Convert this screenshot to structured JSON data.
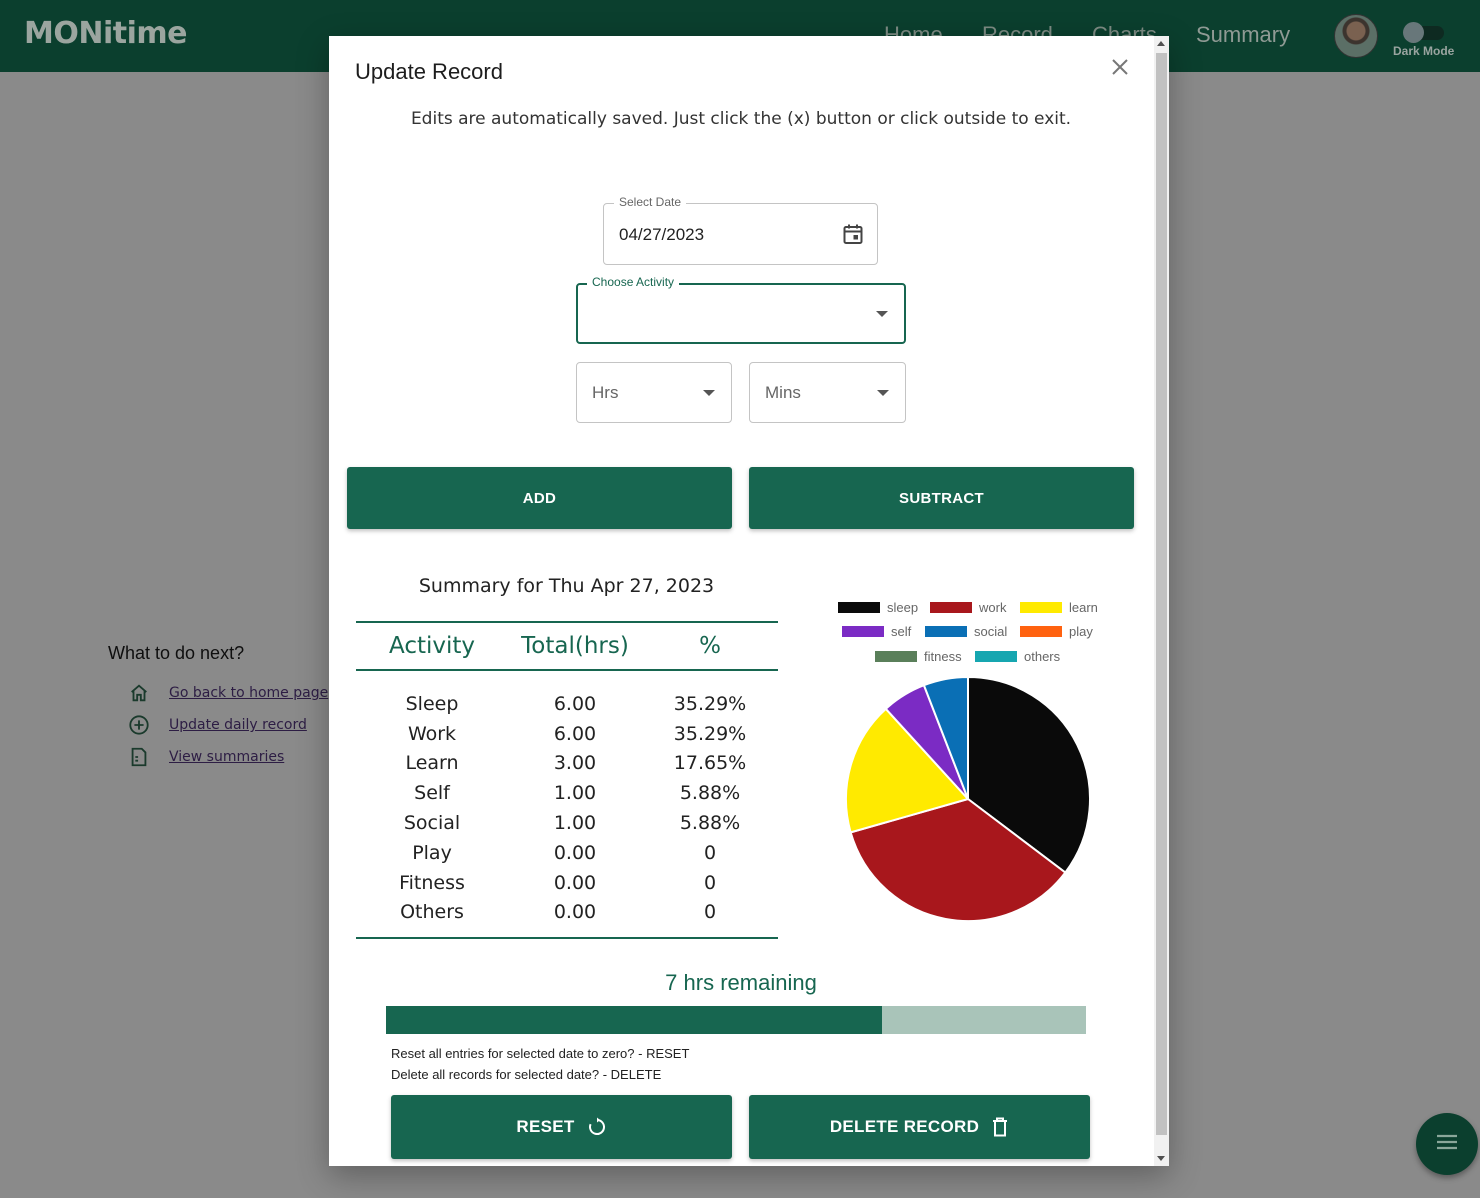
{
  "app": {
    "logo": "MONitime",
    "nav": [
      "Home",
      "Record",
      "Charts",
      "Summary"
    ],
    "dark_mode_label": "Dark Mode"
  },
  "next_steps": {
    "title": "What to do next?",
    "links": [
      {
        "label": "Go back to home page",
        "icon": "home-icon"
      },
      {
        "label": "Update daily record",
        "icon": "plus-circle-icon"
      },
      {
        "label": "View summaries",
        "icon": "document-icon"
      }
    ]
  },
  "modal": {
    "title": "Update Record",
    "hint": "Edits are automatically saved. Just click the (x) button or click outside to exit.",
    "date_field": {
      "label": "Select Date",
      "value": "04/27/2023"
    },
    "activity_field": {
      "label": "Choose Activity",
      "value": ""
    },
    "hrs_placeholder": "Hrs",
    "mins_placeholder": "Mins",
    "add_label": "ADD",
    "subtract_label": "SUBTRACT",
    "summary_title": "Summary for Thu Apr 27, 2023",
    "table": {
      "headers": [
        "Activity",
        "Total(hrs)",
        "%"
      ],
      "rows": [
        [
          "Sleep",
          "6.00",
          "35.29%"
        ],
        [
          "Work",
          "6.00",
          "35.29%"
        ],
        [
          "Learn",
          "3.00",
          "17.65%"
        ],
        [
          "Self",
          "1.00",
          "5.88%"
        ],
        [
          "Social",
          "1.00",
          "5.88%"
        ],
        [
          "Play",
          "0.00",
          "0"
        ],
        [
          "Fitness",
          "0.00",
          "0"
        ],
        [
          "Others",
          "0.00",
          "0"
        ]
      ]
    },
    "remaining_text": "7 hrs remaining",
    "progress_fraction": 0.7083,
    "reset_note": "Reset all entries for selected date to zero? - RESET",
    "delete_note": "Delete all records for selected date? - DELETE",
    "reset_label": "RESET",
    "delete_label": "DELETE RECORD"
  },
  "chart_data": {
    "type": "pie",
    "series": [
      {
        "name": "sleep",
        "value": 6,
        "color": "#0a0a0a"
      },
      {
        "name": "work",
        "value": 6,
        "color": "#a8171c"
      },
      {
        "name": "learn",
        "value": 3,
        "color": "#ffea00"
      },
      {
        "name": "self",
        "value": 1,
        "color": "#7b2bc4"
      },
      {
        "name": "social",
        "value": 1,
        "color": "#0a6fb5"
      },
      {
        "name": "play",
        "value": 0,
        "color": "#ff6210"
      },
      {
        "name": "fitness",
        "value": 0,
        "color": "#5a7f5a"
      },
      {
        "name": "others",
        "value": 0,
        "color": "#16a6b0"
      }
    ],
    "legend_position": "top"
  },
  "colors": {
    "primary": "#176650",
    "topbar": "#0b3f2e",
    "progress_track": "#a9c4b9"
  }
}
